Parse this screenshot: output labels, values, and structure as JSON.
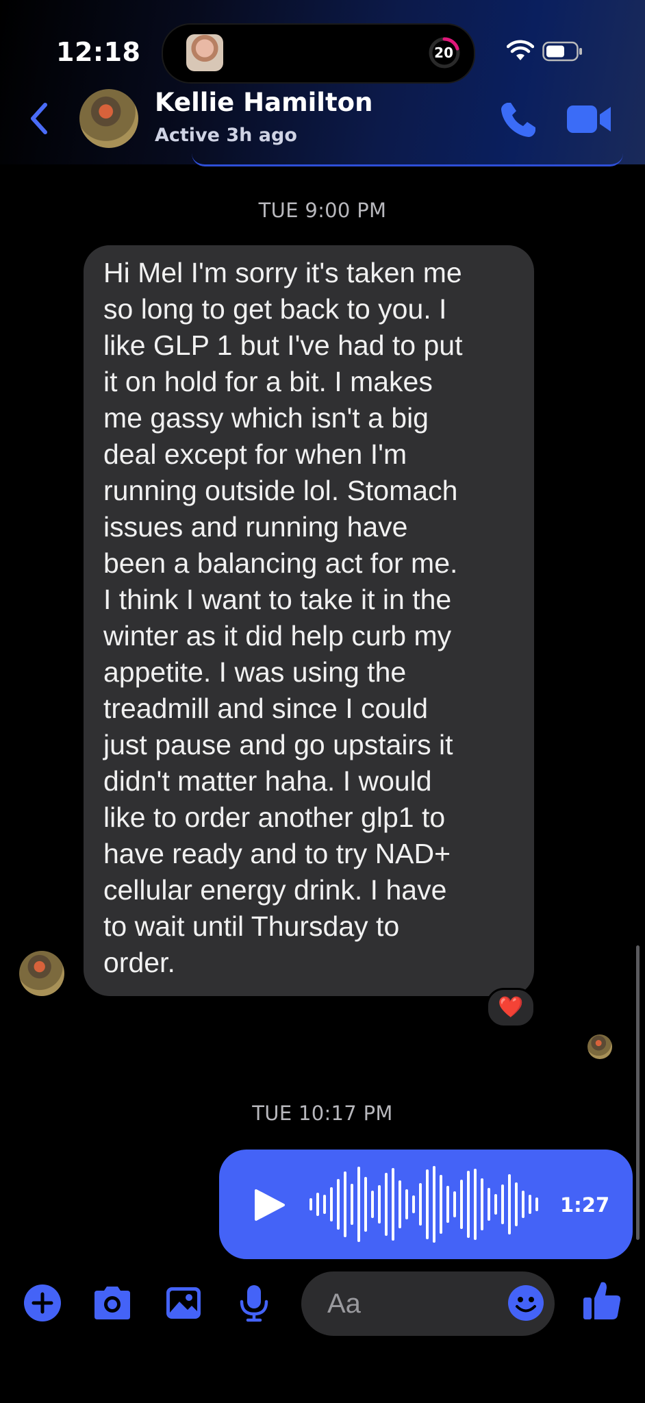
{
  "status_bar": {
    "time": "12:18",
    "activity_count": "20",
    "wifi_icon": "wifi-icon",
    "battery_icon": "battery-icon"
  },
  "header": {
    "back_icon": "chevron-left-icon",
    "contact_name": "Kellie Hamilton",
    "contact_status": "Active 3h ago",
    "call_icon": "phone-icon",
    "video_icon": "video-camera-icon"
  },
  "conversation": {
    "timestamp_1": "TUE 9:00 PM",
    "incoming_message": "Hi Mel I'm sorry it's taken me\nso long to get back to you.  I\nlike GLP 1 but I've had to put\nit on hold for a bit. I makes\nme gassy which isn't a big\ndeal except for when I'm\nrunning outside lol. Stomach\nissues and running have\nbeen a balancing act for me.\nI think I want to take it in the\nwinter as it did help curb my\nappetite.  I was using the\ntreadmill and since I could\njust pause and go upstairs it\ndidn't matter haha.  I would\nlike to order another glp1 to\nhave ready and to try NAD+\ncellular energy drink.  I have\nto wait until Thursday to\norder.",
    "reaction": "❤️",
    "timestamp_2": "TUE 10:17 PM",
    "voice_message": {
      "duration": "1:27",
      "play_icon": "play-icon"
    }
  },
  "composer": {
    "placeholder": "Aa",
    "actions": [
      "plus-icon",
      "camera-icon",
      "image-icon",
      "microphone-icon"
    ],
    "emoji_icon": "emoji-icon",
    "like_icon": "thumbs-up-icon"
  },
  "colors": {
    "accent": "#4463f7",
    "incoming_bubble": "#303032",
    "background": "#000000"
  }
}
